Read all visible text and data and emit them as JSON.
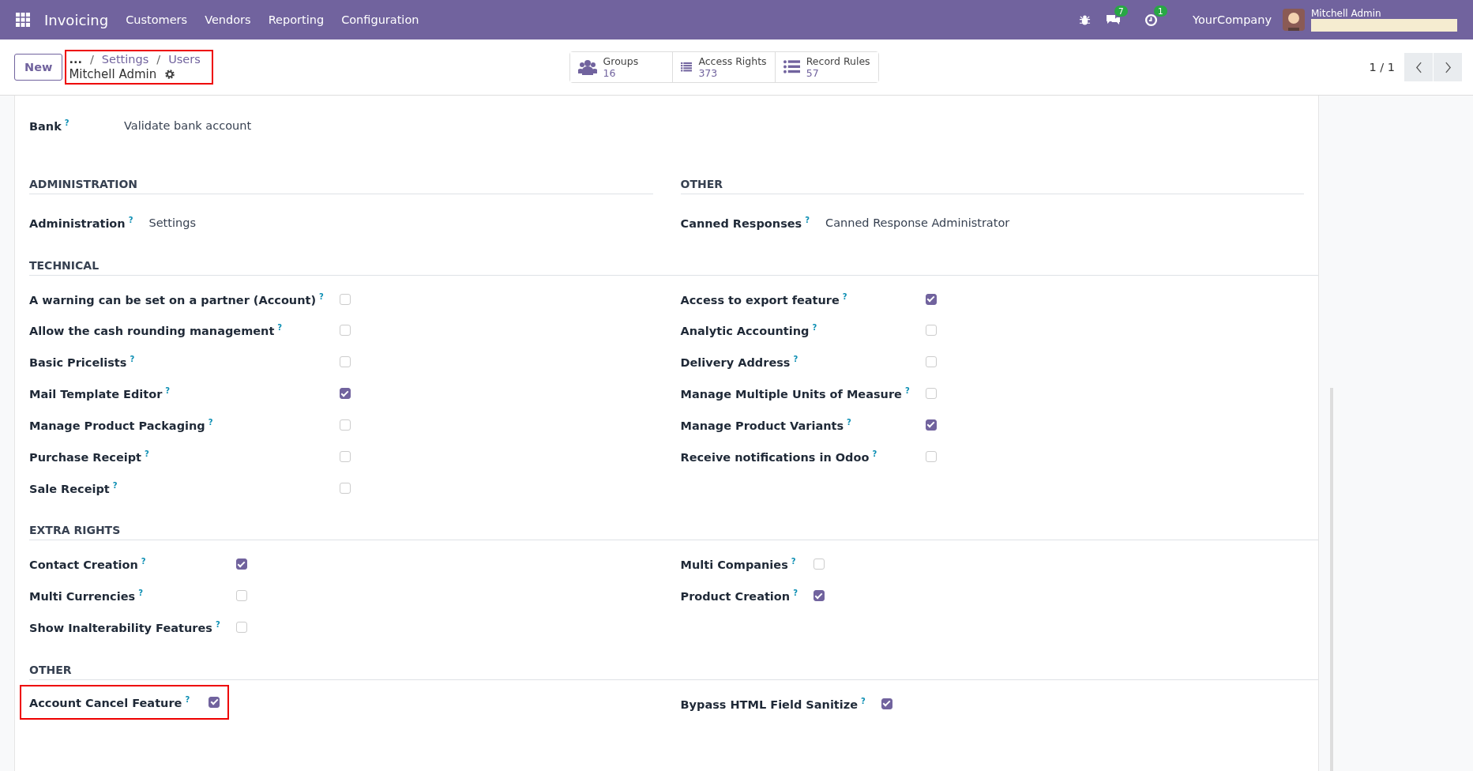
{
  "navbar": {
    "app_name": "Invoicing",
    "menu": [
      "Customers",
      "Vendors",
      "Reporting",
      "Configuration"
    ],
    "messages_count": "7",
    "activities_count": "1",
    "company": "YourCompany",
    "user": "Mitchell Admin"
  },
  "control_panel": {
    "new_button": "New",
    "breadcrumbs": [
      "...",
      "Settings",
      "Users"
    ],
    "breadcrumb_separator": "/",
    "record_title": "Mitchell Admin",
    "stat_buttons": [
      {
        "label": "Groups",
        "value": "16",
        "kind": "groups"
      },
      {
        "label": "Access Rights",
        "value": "373",
        "kind": "list"
      },
      {
        "label": "Record Rules",
        "value": "57",
        "kind": "bullets"
      }
    ],
    "pager": "1 / 1"
  },
  "sections": [
    {
      "kind": "split",
      "left": {
        "fields": [
          {
            "label": "Bank",
            "help": "?",
            "kind": "value",
            "value": "Validate bank account"
          }
        ]
      }
    },
    {
      "kind": "split",
      "left": {
        "title": "ADMINISTRATION",
        "fields": [
          {
            "label": "Administration",
            "help": "?",
            "kind": "value",
            "value": "Settings"
          }
        ]
      },
      "right": {
        "title": "OTHER",
        "fields": [
          {
            "label": "Canned Responses",
            "help": "?",
            "kind": "value",
            "value": "Canned Response Administrator"
          }
        ]
      }
    },
    {
      "kind": "full",
      "title": "TECHNICAL",
      "left": {
        "fields": [
          {
            "label": "A warning can be set on a partner (Account)",
            "help": "?",
            "kind": "checkbox",
            "checked": false
          },
          {
            "label": "Allow the cash rounding management",
            "help": "?",
            "kind": "checkbox",
            "checked": false
          },
          {
            "label": "Basic Pricelists",
            "help": "?",
            "kind": "checkbox",
            "checked": false
          },
          {
            "label": "Mail Template Editor",
            "help": "?",
            "kind": "checkbox",
            "checked": true
          },
          {
            "label": "Manage Product Packaging",
            "help": "?",
            "kind": "checkbox",
            "checked": false
          },
          {
            "label": "Purchase Receipt",
            "help": "?",
            "kind": "checkbox",
            "checked": false
          },
          {
            "label": "Sale Receipt",
            "help": "?",
            "kind": "checkbox",
            "checked": false
          }
        ]
      },
      "right": {
        "fields": [
          {
            "label": "Access to export feature",
            "help": "?",
            "kind": "checkbox",
            "checked": true
          },
          {
            "label": "Analytic Accounting",
            "help": "?",
            "kind": "checkbox",
            "checked": false
          },
          {
            "label": "Delivery Address",
            "help": "?",
            "kind": "checkbox",
            "checked": false
          },
          {
            "label": "Manage Multiple Units of Measure",
            "help": "?",
            "kind": "checkbox",
            "checked": false
          },
          {
            "label": "Manage Product Variants",
            "help": "?",
            "kind": "checkbox",
            "checked": true
          },
          {
            "label": "Receive notifications in Odoo",
            "help": "?",
            "kind": "checkbox",
            "checked": false
          }
        ]
      }
    },
    {
      "kind": "full",
      "title": "EXTRA RIGHTS",
      "left": {
        "fields": [
          {
            "label": "Contact Creation",
            "help": "?",
            "kind": "checkbox",
            "checked": true
          },
          {
            "label": "Multi Currencies",
            "help": "?",
            "kind": "checkbox",
            "checked": false
          },
          {
            "label": "Show Inalterability Features",
            "help": "?",
            "kind": "checkbox",
            "checked": false
          }
        ]
      },
      "right": {
        "fields": [
          {
            "label": "Multi Companies",
            "help": "?",
            "kind": "checkbox",
            "checked": false
          },
          {
            "label": "Product Creation",
            "help": "?",
            "kind": "checkbox",
            "checked": true
          }
        ]
      }
    },
    {
      "kind": "full",
      "title": "OTHER",
      "left": {
        "highlighted": true,
        "fields": [
          {
            "label": "Account Cancel Feature",
            "help": "?",
            "kind": "checkbox",
            "checked": true
          }
        ]
      },
      "right": {
        "fields": [
          {
            "label": "Bypass HTML Field Sanitize",
            "help": "?",
            "kind": "checkbox",
            "checked": true
          }
        ]
      }
    }
  ],
  "annotations": {
    "breadcrumb_highlighted": true
  }
}
